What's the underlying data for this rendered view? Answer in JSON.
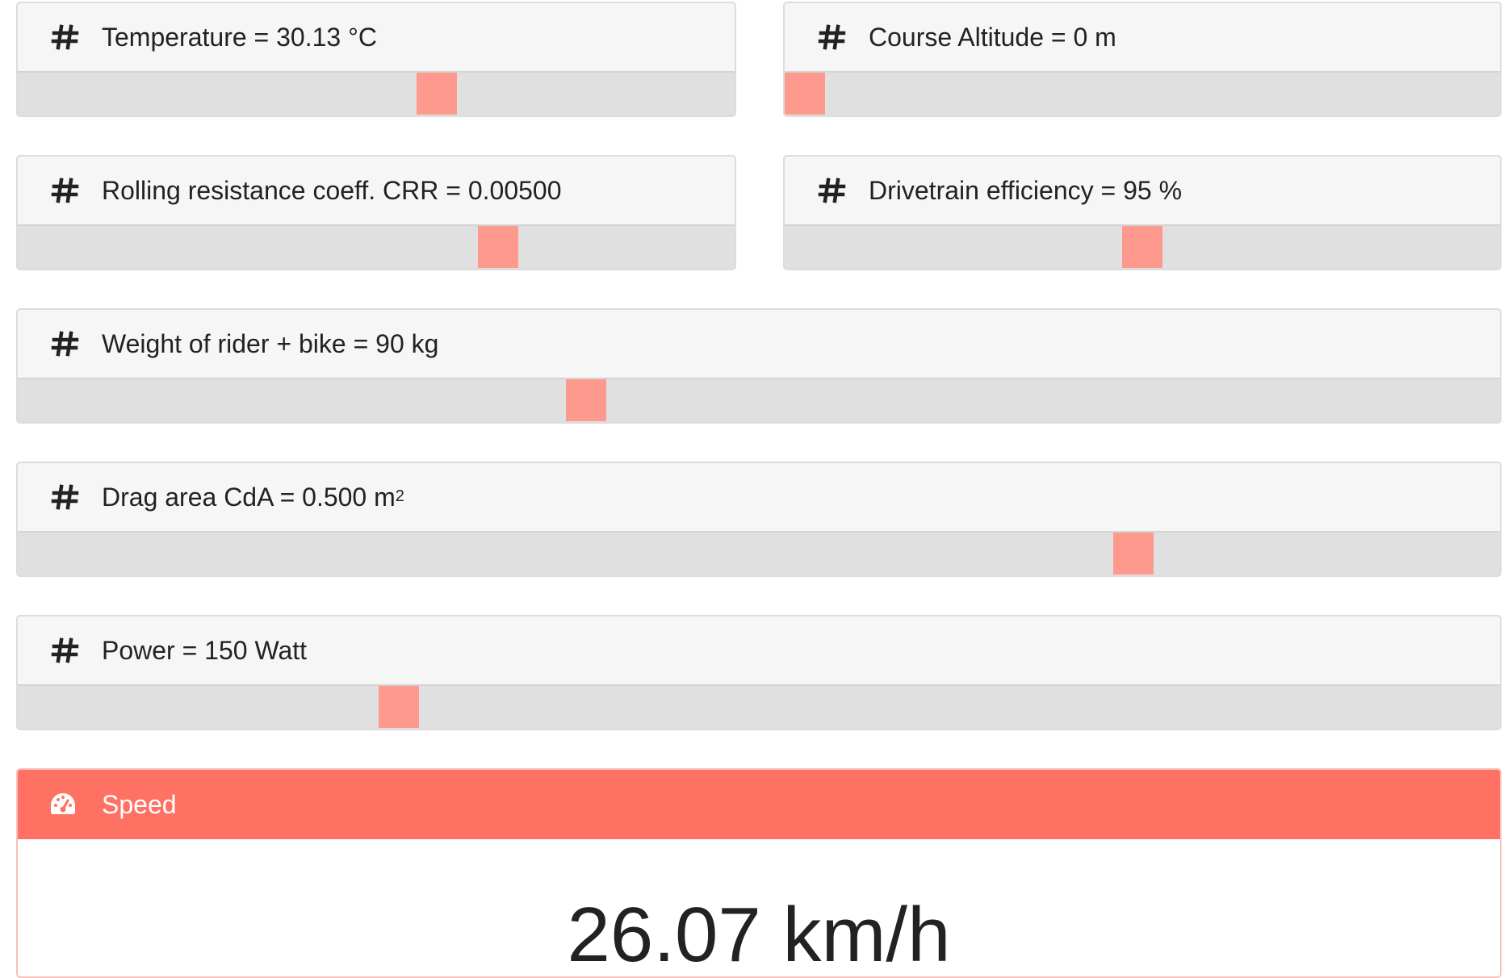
{
  "params": [
    {
      "label": "Temperature = 30.13 °C",
      "level_pct": 59
    },
    {
      "label": "Course Altitude = 0 m",
      "level_pct": 0
    },
    {
      "label": "Rolling resistance coeff. CRR = 0.00500",
      "level_pct": 68
    },
    {
      "label": "Drivetrain efficiency = 95 %",
      "level_pct": 50
    },
    {
      "label": "Weight of rider + bike = 90 kg",
      "level_pct": 38
    },
    {
      "label": "Drag area CdA = 0.500 m",
      "label_sup": "2",
      "level_pct": 76
    },
    {
      "label": "Power = 150 Watt",
      "level_pct": 25
    }
  ],
  "result": {
    "title": "Speed",
    "value": "26.07 km/h"
  },
  "icons": {
    "param": "hash-icon",
    "result": "gauge-icon"
  },
  "colors": {
    "accent": "#fe7163",
    "thumb": "#fe9a8d",
    "track": "#e0e0e0",
    "header": "#f6f6f6"
  }
}
